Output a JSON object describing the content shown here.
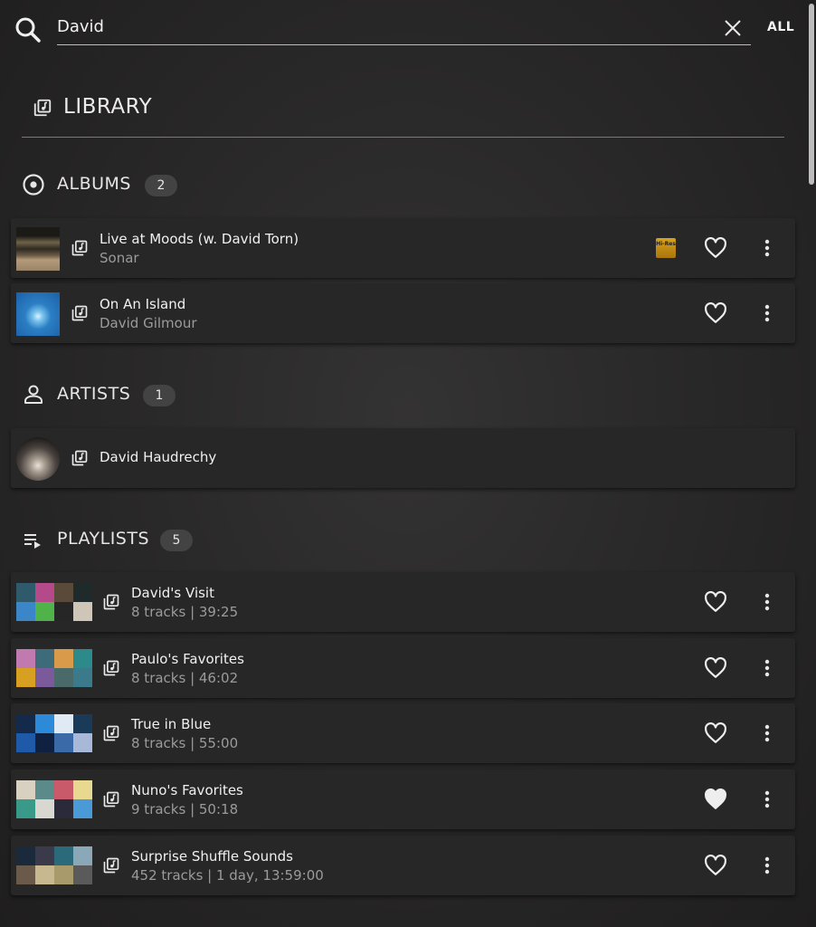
{
  "search": {
    "value": "David",
    "scope_label": "ALL"
  },
  "library": {
    "title": "LIBRARY"
  },
  "albums": {
    "title": "ALBUMS",
    "count": "2",
    "items": [
      {
        "title": "Live at Moods (w. David Torn)",
        "subtitle": "Sonar",
        "hires_badge": "Hi-Res",
        "favorite": false
      },
      {
        "title": "On An Island",
        "subtitle": "David Gilmour",
        "favorite": false
      }
    ]
  },
  "artists": {
    "title": "ARTISTS",
    "count": "1",
    "items": [
      {
        "name": "David Haudrechy"
      }
    ]
  },
  "playlists": {
    "title": "PLAYLISTS",
    "count": "5",
    "items": [
      {
        "title": "David's Visit",
        "subtitle": "8 tracks | 39:25",
        "favorite": false
      },
      {
        "title": "Paulo's Favorites",
        "subtitle": "8 tracks | 46:02",
        "favorite": false
      },
      {
        "title": "True in Blue",
        "subtitle": "8 tracks | 55:00",
        "favorite": false
      },
      {
        "title": "Nuno's Favorites",
        "subtitle": "9 tracks | 50:18",
        "favorite": true
      },
      {
        "title": "Surprise Shuffle Sounds",
        "subtitle": "452 tracks | 1 day, 13:59:00",
        "favorite": false
      }
    ]
  },
  "colors": {
    "divider_accent": "#8a7560",
    "hires_gold": "#d9a21a",
    "row_bg": "#272727"
  }
}
